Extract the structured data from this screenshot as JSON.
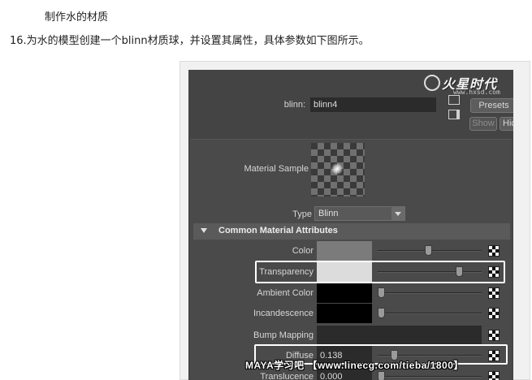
{
  "article": {
    "heading": "制作水的材质",
    "step": "16.为水的模型创建一个blinn材质球，并设置其属性，具体参数如下图所示。"
  },
  "logo": {
    "brand": "火星时代",
    "url": "www.hxsd.com"
  },
  "header": {
    "blinn_label": "blinn:",
    "blinn_value": "blinn4",
    "presets_label": "Presets",
    "show_label": "Show",
    "hide_label": "Hic"
  },
  "sample": {
    "label": "Material Sample"
  },
  "type": {
    "label": "Type",
    "value": "Blinn"
  },
  "section": {
    "title": "Common Material Attributes"
  },
  "attributes": [
    {
      "label": "Color",
      "value": "",
      "swatch": "#7b7b7b",
      "level": 0.49
    },
    {
      "label": "Transparency",
      "value": "",
      "swatch": "#dcdcdc",
      "level": 0.81
    },
    {
      "label": "Ambient Color",
      "value": "",
      "swatch": "#000000",
      "level": 0.0
    },
    {
      "label": "Incandescence",
      "value": "",
      "swatch": "#000000",
      "level": 0.0
    },
    {
      "label": "Bump Mapping",
      "value": "",
      "swatch": "#2b2b2b",
      "level": null
    },
    {
      "label": "Diffuse",
      "value": "0.138",
      "swatch": "#2b2b2b",
      "level": 0.138
    },
    {
      "label": "Translucence",
      "value": "0.000",
      "swatch": "#2b2b2b",
      "level": 0.0
    }
  ],
  "watermark": "MAYA学习吧 【www.linecg.com/tieba/1800】",
  "colors": {
    "panel_bg": "#444444",
    "highlight": "#ffffff"
  }
}
